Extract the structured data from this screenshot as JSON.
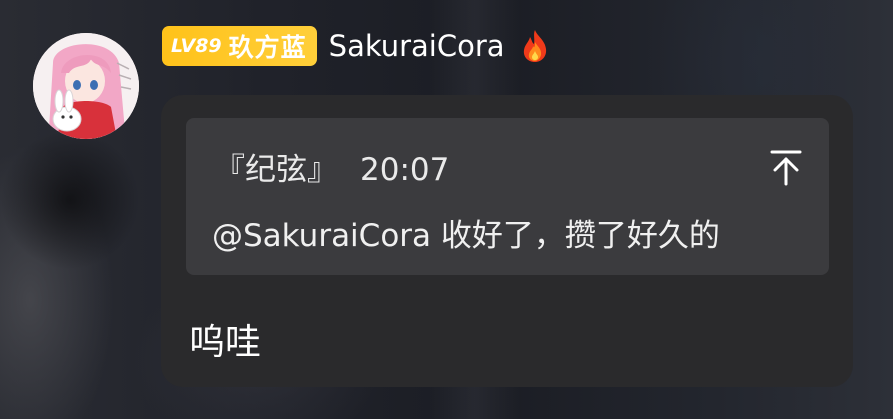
{
  "sender": {
    "level_label": "LV89",
    "group_name": "玖方蓝",
    "username": "SakuraiCora",
    "avatar_icon": "anime-avatar-icon",
    "status_icon": "fire-icon"
  },
  "quoted": {
    "author": "『纪弦』",
    "time": "20:07",
    "text": "@SakuraiCora 收好了，攒了好久的",
    "action_icon": "scroll-to-top-icon"
  },
  "message": {
    "text": "呜哇"
  },
  "colors": {
    "badge": "#ffc21a",
    "bubble": "#2a2a2c",
    "quote": "#3b3b3e"
  }
}
